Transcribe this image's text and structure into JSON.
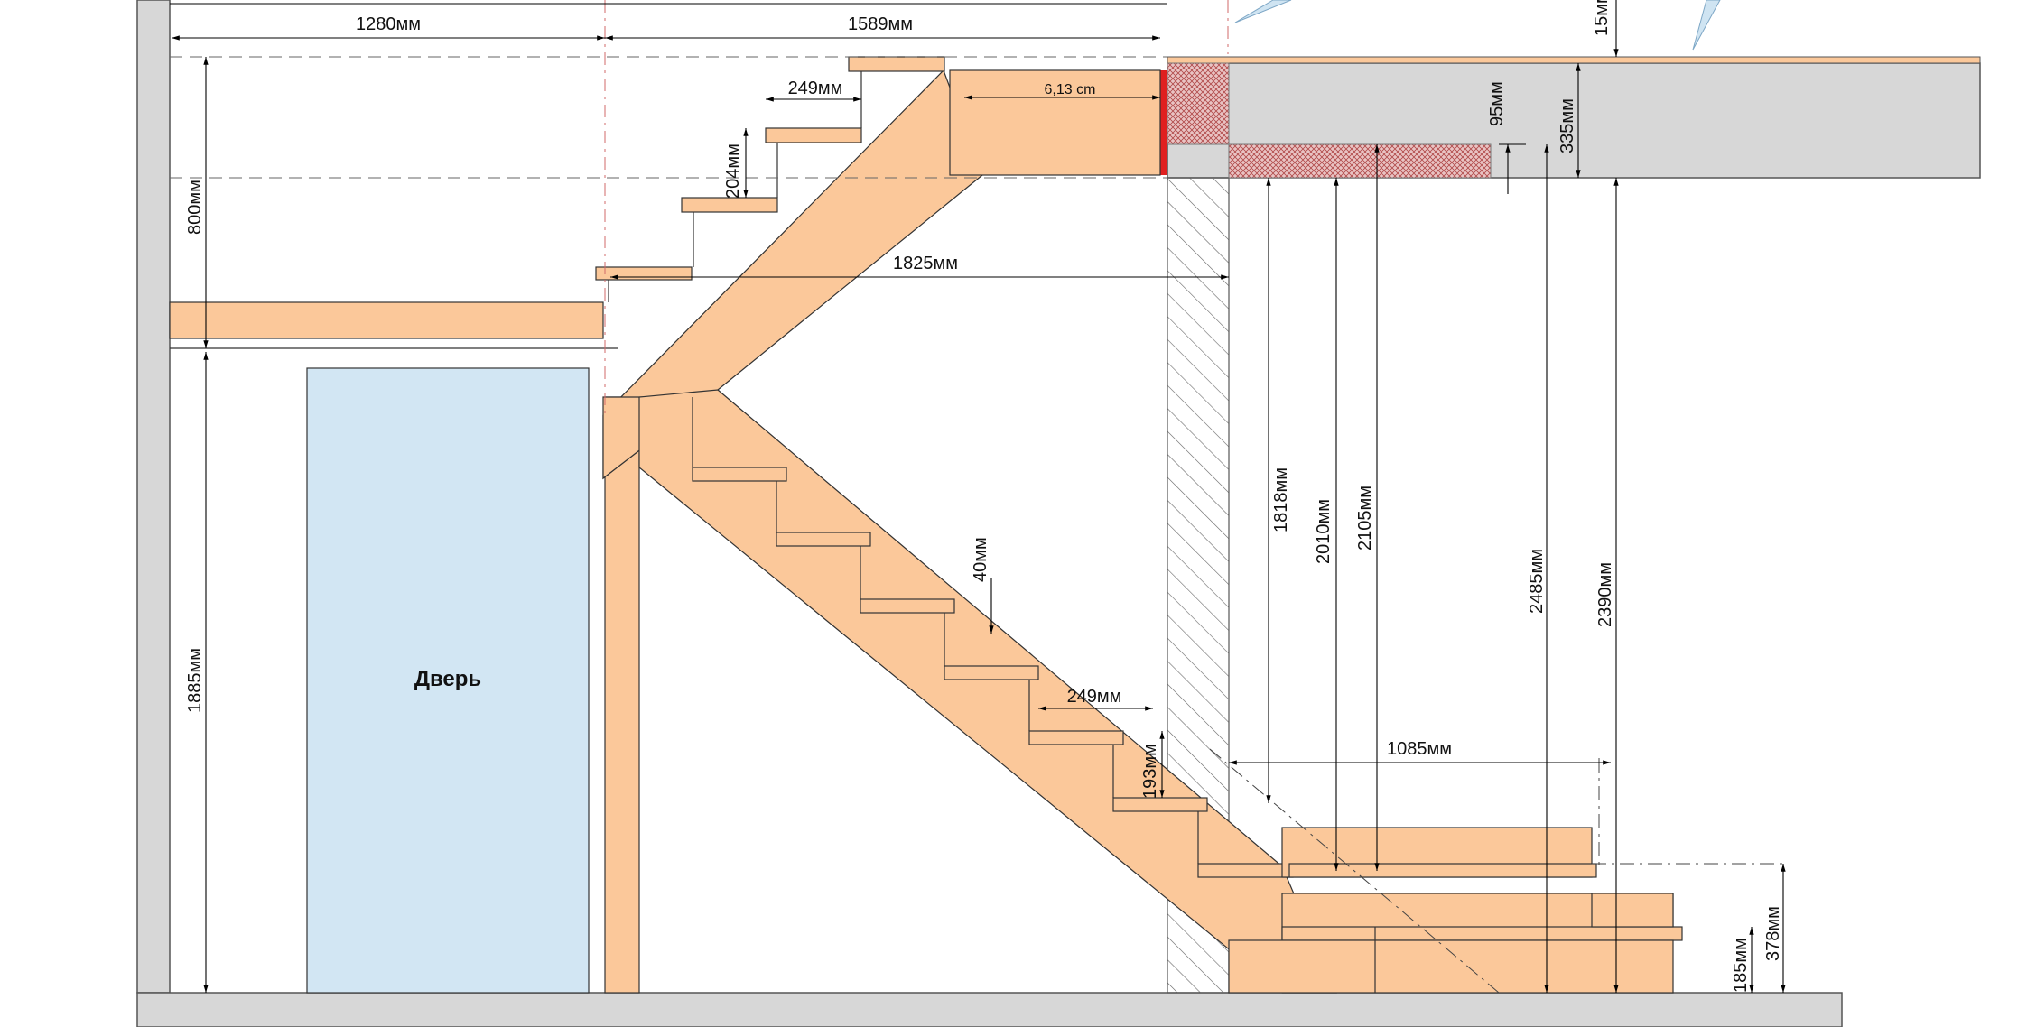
{
  "door": {
    "label": "Дверь"
  },
  "dimensions": {
    "top_left_width": "1280мм",
    "top_right_width": "1589мм",
    "slab_gap_top": "15мм",
    "upper_tread_depth": "249мм",
    "upper_riser": "204мм",
    "beam_width": "6,13 cm",
    "landing_span": "1825мм",
    "upper_floor_height": "800мм",
    "door_height": "1885мм",
    "slab_recess": "95мм",
    "slab_thickness": "335мм",
    "tread_thickness": "40мм",
    "lower_tread_depth": "249мм",
    "lower_riser": "193мм",
    "bottom_landing_width": "1085мм",
    "headroom_1": "1818мм",
    "headroom_2": "2010мм",
    "headroom_3": "2105мм",
    "headroom_4": "2485мм",
    "ceiling_height": "2390мм",
    "first_step_height": "185мм",
    "second_step_height": "378мм"
  },
  "colors": {
    "wood": "#fbc89a",
    "wall": "#d7d7d7",
    "door": "#d2e6f3",
    "beam_hatch": "#c65a5a",
    "red_accent": "#e02020"
  }
}
